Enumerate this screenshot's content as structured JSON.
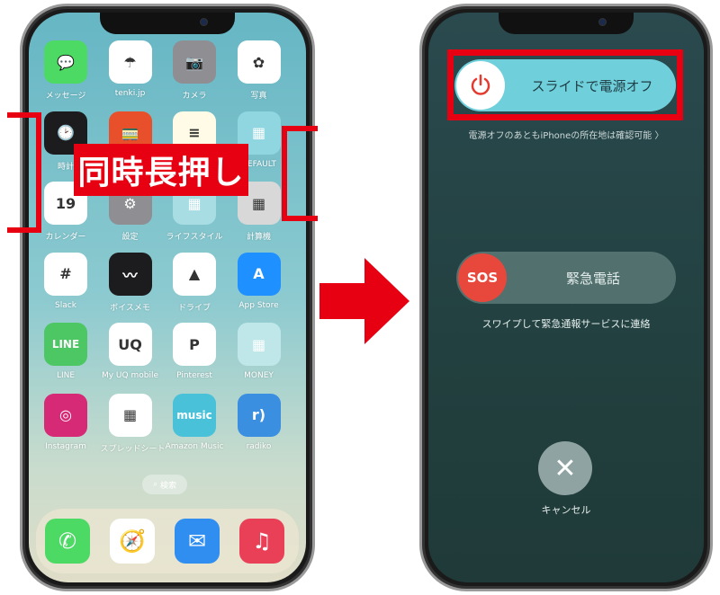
{
  "left_phone": {
    "apps": [
      {
        "label": "メッセージ",
        "icon": "messages-icon",
        "color": "#4cd964",
        "glyph": "💬"
      },
      {
        "label": "tenki.jp",
        "icon": "tenki-icon",
        "color": "#ffffff",
        "glyph": "☂"
      },
      {
        "label": "カメラ",
        "icon": "camera-icon",
        "color": "#8e8e93",
        "glyph": "📷"
      },
      {
        "label": "写真",
        "icon": "photos-icon",
        "color": "#ffffff",
        "glyph": "✿"
      },
      {
        "label": "時計",
        "icon": "clock-icon",
        "color": "#1c1c1e",
        "glyph": "🕑"
      },
      {
        "label": "",
        "icon": "train-icon",
        "color": "#e8502c",
        "glyph": "🚃"
      },
      {
        "label": "",
        "icon": "notes-icon",
        "color": "#fffbe6",
        "glyph": "≡"
      },
      {
        "label": "DEFAULT",
        "icon": "folder-icon",
        "color": "#8fd6e0",
        "glyph": "▦"
      },
      {
        "label": "カレンダー",
        "icon": "calendar-icon",
        "color": "#ffffff",
        "glyph": "19"
      },
      {
        "label": "設定",
        "icon": "settings-icon",
        "color": "#8e8e93",
        "glyph": "⚙"
      },
      {
        "label": "ライフスタイル",
        "icon": "folder-icon",
        "color": "#a8dde4",
        "glyph": "▦"
      },
      {
        "label": "計算機",
        "icon": "calculator-icon",
        "color": "#d8d8d8",
        "glyph": "▦"
      },
      {
        "label": "Slack",
        "icon": "slack-icon",
        "color": "#ffffff",
        "glyph": "#"
      },
      {
        "label": "ボイスメモ",
        "icon": "voice-memo-icon",
        "color": "#1c1c1e",
        "glyph": "〰"
      },
      {
        "label": "ドライブ",
        "icon": "drive-icon",
        "color": "#ffffff",
        "glyph": "▲"
      },
      {
        "label": "App Store",
        "icon": "app-store-icon",
        "color": "#1e90ff",
        "glyph": "A"
      },
      {
        "label": "LINE",
        "icon": "line-icon",
        "color": "#4cc764",
        "glyph": "LINE"
      },
      {
        "label": "My UQ mobile",
        "icon": "uq-mobile-icon",
        "color": "#ffffff",
        "glyph": "UQ"
      },
      {
        "label": "Pinterest",
        "icon": "pinterest-icon",
        "color": "#ffffff",
        "glyph": "P"
      },
      {
        "label": "MONEY",
        "icon": "folder-icon",
        "color": "#bfe7ea",
        "glyph": "▦"
      },
      {
        "label": "Instagram",
        "icon": "instagram-icon",
        "color": "#d62976",
        "glyph": "◎"
      },
      {
        "label": "スプレッドシート",
        "icon": "sheets-icon",
        "color": "#ffffff",
        "glyph": "▦"
      },
      {
        "label": "Amazon Music",
        "icon": "amazon-music-icon",
        "color": "#49c1d8",
        "glyph": "music"
      },
      {
        "label": "radiko",
        "icon": "radiko-icon",
        "color": "#3b8fe0",
        "glyph": "r)"
      }
    ],
    "search_label": "検索",
    "dock": [
      {
        "icon": "phone-icon",
        "color": "#4cd964",
        "glyph": "✆"
      },
      {
        "icon": "safari-icon",
        "color": "#ffffff",
        "glyph": "🧭"
      },
      {
        "icon": "mail-icon",
        "color": "#2f8ef0",
        "glyph": "✉"
      },
      {
        "icon": "music-icon",
        "color": "#e94057",
        "glyph": "♫"
      }
    ],
    "callout": "同時長押し"
  },
  "right_phone": {
    "power_slider": "スライドで電源オフ",
    "find_my_note": "電源オフのあともiPhoneの所在地は確認可能 〉",
    "sos_knob": "SOS",
    "sos_slider": "緊急電話",
    "sos_note": "スワイプして緊急通報サービスに連絡",
    "cancel_label": "キャンセル"
  },
  "colors": {
    "highlight": "#e60012",
    "power_slider": "#6fd0dc",
    "sos": "#e8473c"
  }
}
